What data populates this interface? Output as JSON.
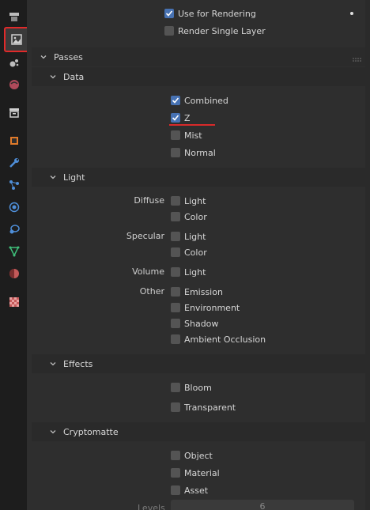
{
  "top": {
    "use_for_rendering": {
      "label": "Use for Rendering",
      "checked": true
    },
    "render_single_layer": {
      "label": "Render Single Layer",
      "checked": false
    }
  },
  "passes": {
    "title": "Passes",
    "data": {
      "title": "Data",
      "items": [
        {
          "label": "Combined",
          "checked": true
        },
        {
          "label": "Z",
          "checked": true
        },
        {
          "label": "Mist",
          "checked": false
        },
        {
          "label": "Normal",
          "checked": false
        }
      ]
    },
    "light": {
      "title": "Light",
      "diffuse": {
        "label": "Diffuse",
        "light": "Light",
        "color": "Color"
      },
      "specular": {
        "label": "Specular",
        "light": "Light",
        "color": "Color"
      },
      "volume": {
        "label": "Volume",
        "light": "Light"
      },
      "other": {
        "label": "Other",
        "emission": "Emission",
        "environment": "Environment",
        "shadow": "Shadow",
        "ao": "Ambient Occlusion"
      }
    },
    "effects": {
      "title": "Effects",
      "bloom": "Bloom",
      "transparent": "Transparent"
    },
    "cryptomatte": {
      "title": "Cryptomatte",
      "object": "Object",
      "material": "Material",
      "asset": "Asset",
      "levels_label": "Levels",
      "levels_value": "6"
    }
  },
  "sidebar_icons": [
    "tool-icon",
    "render-icon",
    "output-icon",
    "view-layer-icon",
    "scene-icon",
    "world-icon",
    "collection-icon",
    "object-icon",
    "modifier-icon",
    "particles-icon",
    "physics-icon",
    "constraints-icon",
    "data-icon",
    "material-icon",
    "texture-icon"
  ],
  "colors": {
    "accent": "#4772b3",
    "highlight": "#e02a2a"
  }
}
